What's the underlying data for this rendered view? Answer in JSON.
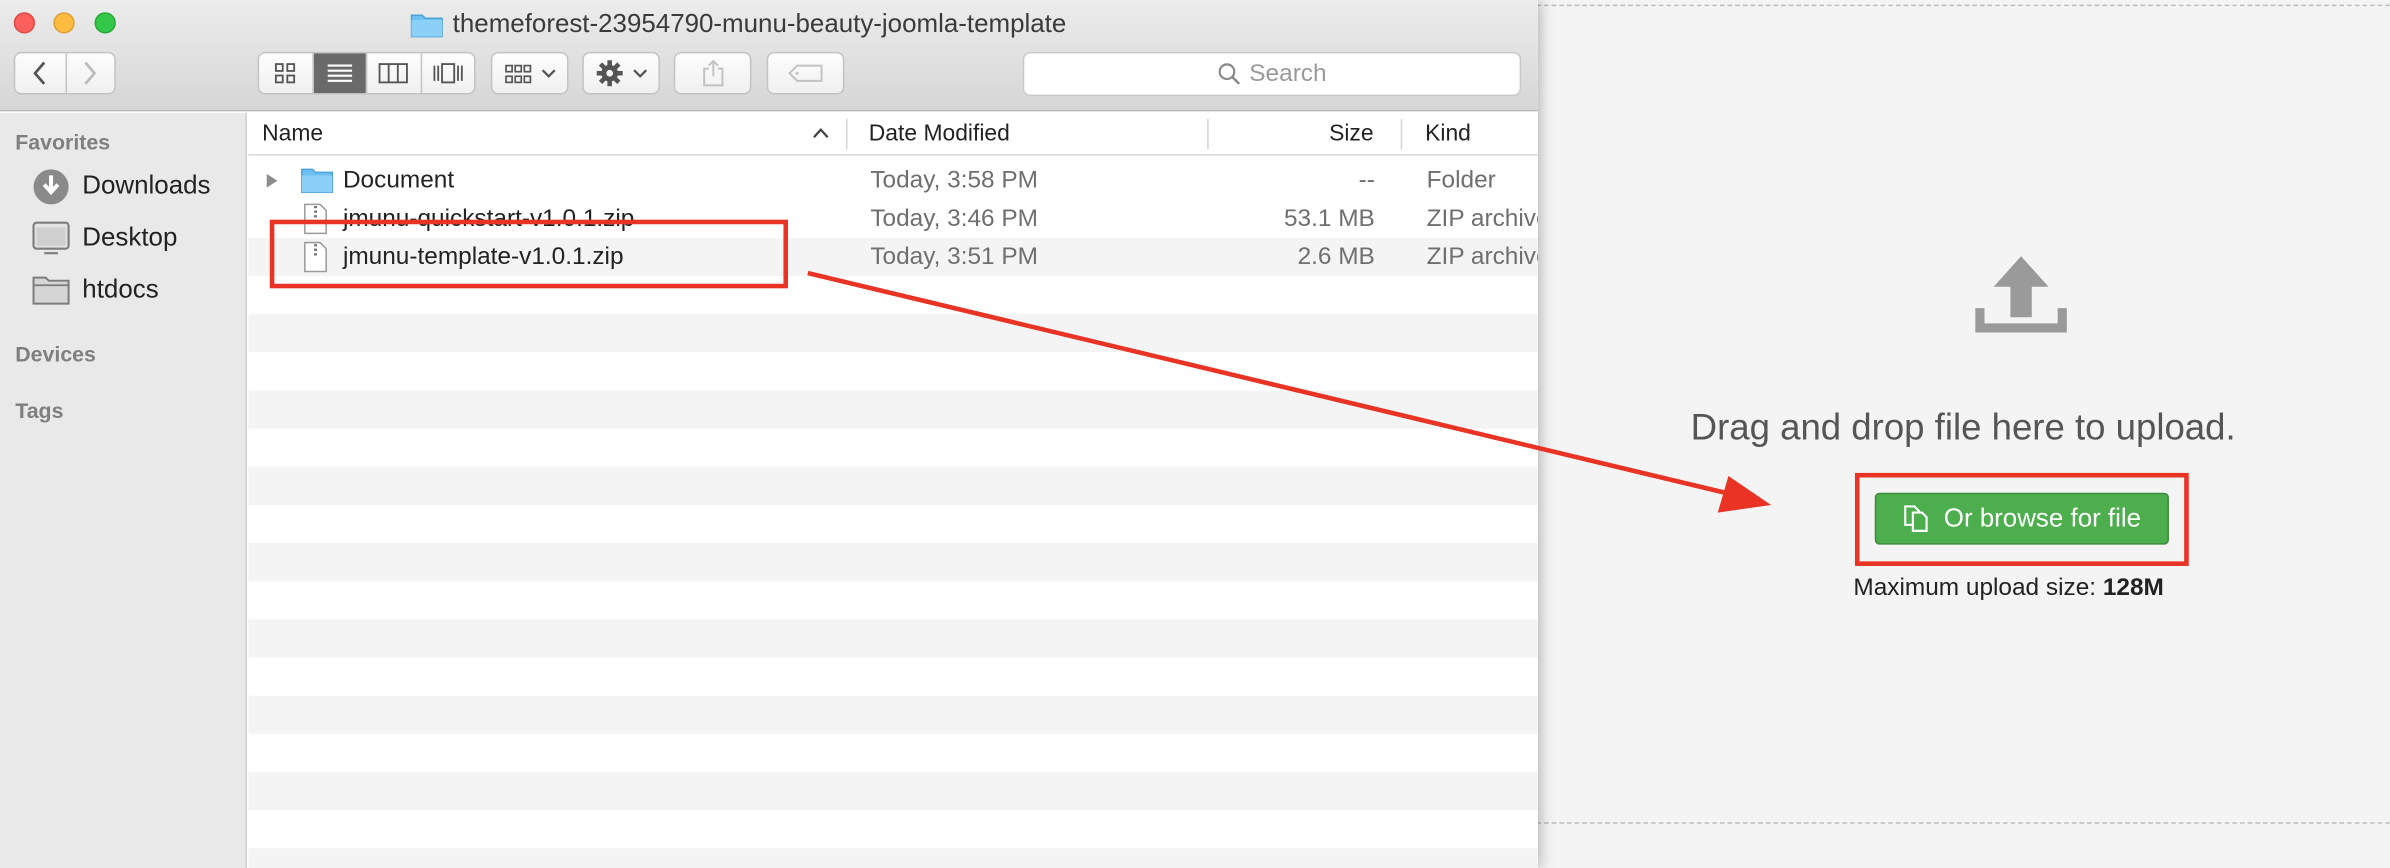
{
  "window": {
    "title": "themeforest-23954790-munu-beauty-joomla-template",
    "search_placeholder": "Search"
  },
  "sidebar": {
    "favorites_label": "Favorites",
    "items": [
      {
        "label": "Downloads",
        "icon": "downloads-icon"
      },
      {
        "label": "Desktop",
        "icon": "desktop-icon"
      },
      {
        "label": "htdocs",
        "icon": "folder-icon"
      }
    ],
    "devices_label": "Devices",
    "tags_label": "Tags"
  },
  "columns": {
    "name": "Name",
    "date_modified": "Date Modified",
    "size": "Size",
    "kind": "Kind"
  },
  "files": [
    {
      "name": "Document",
      "date": "Today, 3:58 PM",
      "size": "--",
      "kind": "Folder",
      "type": "folder"
    },
    {
      "name": "jmunu-quickstart-v1.0.1.zip",
      "date": "Today, 3:46 PM",
      "size": "53.1 MB",
      "kind": "ZIP archive",
      "type": "zip"
    },
    {
      "name": "jmunu-template-v1.0.1.zip",
      "date": "Today, 3:51 PM",
      "size": "2.6 MB",
      "kind": "ZIP archive",
      "type": "zip"
    }
  ],
  "upload": {
    "drop_text": "Drag and drop file here to upload.",
    "browse_label": "Or browse for file",
    "max_label": "Maximum upload size:",
    "max_value": "128M"
  },
  "colors": {
    "accent_green": "#4cae4c",
    "annotation_red": "#e83325",
    "folder_blue": "#6cc0f2"
  }
}
